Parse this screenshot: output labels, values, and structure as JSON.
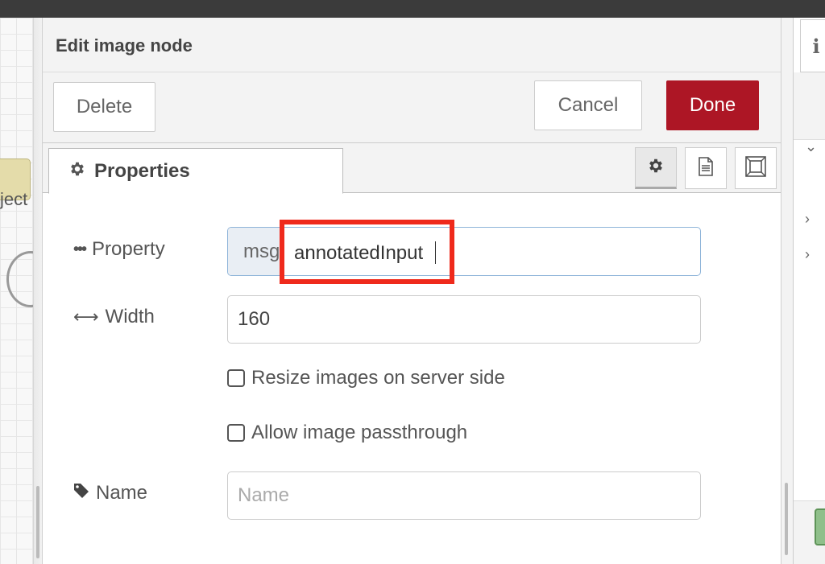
{
  "dialog": {
    "title": "Edit image node",
    "delete_label": "Delete",
    "cancel_label": "Cancel",
    "done_label": "Done"
  },
  "tabs": {
    "properties_label": "Properties",
    "icons": [
      "gear-icon",
      "description-icon",
      "appearance-icon"
    ]
  },
  "form": {
    "property": {
      "label": "Property",
      "prefix": "msg.",
      "value": "annotatedInput"
    },
    "width": {
      "label": "Width",
      "value": "160"
    },
    "resize_checkbox": {
      "label": "Resize images on server side",
      "checked": false
    },
    "passthrough_checkbox": {
      "label": "Allow image passthrough",
      "checked": false
    },
    "name": {
      "label": "Name",
      "placeholder": "Name",
      "value": ""
    }
  },
  "workspace": {
    "node_label_fragment": "ject"
  },
  "sidebar": {
    "tab_label": "i"
  },
  "colors": {
    "done": "#ad1625",
    "highlight": "#ef2a1c",
    "focus_border": "#8eb4d9"
  }
}
